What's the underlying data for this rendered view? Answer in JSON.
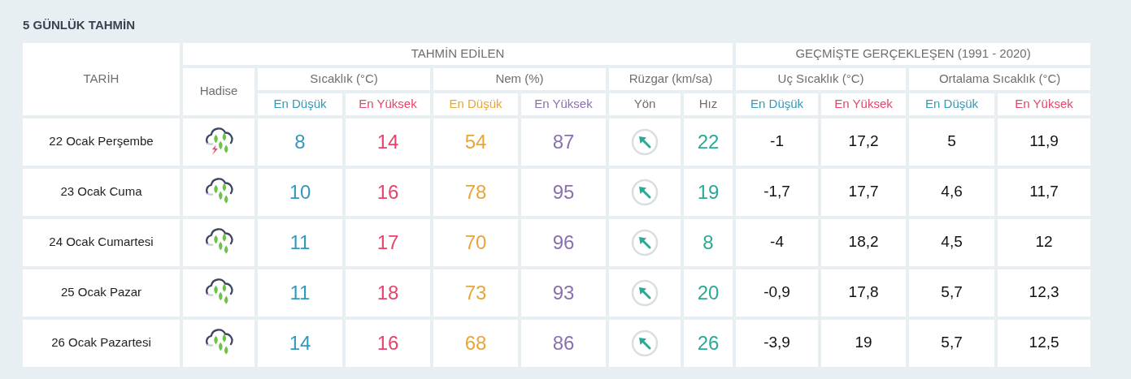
{
  "title": "5 GÜNLÜK TAHMİN",
  "headers": {
    "date": "TARİH",
    "forecast_group": "TAHMİN EDİLEN",
    "history_group": "GEÇMİŞTE GERÇEKLEŞEN (1991 - 2020)",
    "event": "Hadise",
    "groups": [
      {
        "label": "Sıcaklık (°C)"
      },
      {
        "label": "Nem (%)"
      },
      {
        "label": "Rüzgar (km/sa)"
      },
      {
        "label": "Uç Sıcaklık (°C)"
      },
      {
        "label": "Ortalama Sıcaklık (°C)"
      }
    ],
    "subcolumns": [
      {
        "label": "En Düşük",
        "color": "#3399bb"
      },
      {
        "label": "En Yüksek",
        "color": "#e8436a"
      },
      {
        "label": "En Düşük",
        "color": "#e8a53a"
      },
      {
        "label": "En Yüksek",
        "color": "#8a70b0"
      },
      {
        "label": "Yön",
        "color": "#6e6e6e"
      },
      {
        "label": "Hız",
        "color": "#6e6e6e"
      },
      {
        "label": "En Düşük",
        "color": "#3399bb"
      },
      {
        "label": "En Yüksek",
        "color": "#e8436a"
      },
      {
        "label": "En Düşük",
        "color": "#3399bb"
      },
      {
        "label": "En Yüksek",
        "color": "#e8436a"
      }
    ]
  },
  "rows": [
    {
      "date": "22 Ocak Perşembe",
      "kind": "thunder-rain",
      "values": [
        "8",
        "14",
        "54",
        "87",
        "22",
        "-1",
        "17,2",
        "5",
        "11,9"
      ]
    },
    {
      "date": "23 Ocak Cuma",
      "kind": "rain",
      "values": [
        "10",
        "16",
        "78",
        "95",
        "19",
        "-1,7",
        "17,7",
        "4,6",
        "11,7"
      ]
    },
    {
      "date": "24 Ocak Cumartesi",
      "kind": "rain",
      "values": [
        "11",
        "17",
        "70",
        "96",
        "8",
        "-4",
        "18,2",
        "4,5",
        "12"
      ]
    },
    {
      "date": "25 Ocak Pazar",
      "kind": "rain",
      "values": [
        "11",
        "18",
        "73",
        "93",
        "20",
        "-0,9",
        "17,8",
        "5,7",
        "12,3"
      ]
    },
    {
      "date": "26 Ocak Pazartesi",
      "kind": "rain",
      "values": [
        "14",
        "16",
        "68",
        "86",
        "26",
        "-3,9",
        "19",
        "5,7",
        "12,5"
      ]
    }
  ]
}
